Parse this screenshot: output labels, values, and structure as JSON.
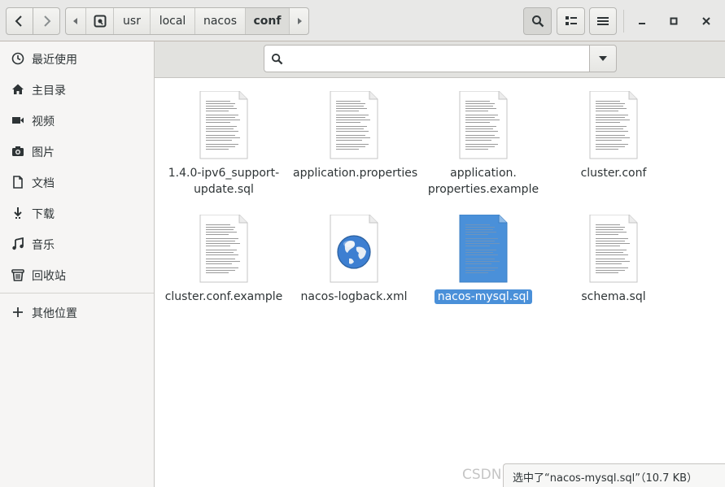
{
  "header": {
    "path": [
      {
        "label": "",
        "icon": "drive-icon"
      },
      {
        "label": "usr"
      },
      {
        "label": "local"
      },
      {
        "label": "nacos"
      },
      {
        "label": "conf"
      }
    ]
  },
  "sidebar": {
    "items": [
      {
        "label": "最近使用",
        "icon": "clock-icon"
      },
      {
        "label": "主目录",
        "icon": "home-icon"
      },
      {
        "label": "视频",
        "icon": "video-icon"
      },
      {
        "label": "图片",
        "icon": "camera-icon"
      },
      {
        "label": "文档",
        "icon": "document-icon"
      },
      {
        "label": "下载",
        "icon": "download-icon"
      },
      {
        "label": "音乐",
        "icon": "music-icon"
      },
      {
        "label": "回收站",
        "icon": "trash-icon"
      }
    ],
    "other": {
      "label": "其他位置",
      "icon": "plus-icon"
    }
  },
  "search": {
    "value": "",
    "placeholder": ""
  },
  "files": [
    {
      "name1": "1.4.0-ipv6_support-",
      "name2": "update.sql",
      "type": "text"
    },
    {
      "name1": "application.properties",
      "name2": "",
      "type": "text"
    },
    {
      "name1": "application.",
      "name2": "properties.example",
      "type": "text"
    },
    {
      "name1": "cluster.conf",
      "name2": "",
      "type": "text"
    },
    {
      "name1": "cluster.conf.example",
      "name2": "",
      "type": "text"
    },
    {
      "name1": "nacos-logback.xml",
      "name2": "",
      "type": "xml"
    },
    {
      "name1": "nacos-mysql.sql",
      "name2": "",
      "type": "text",
      "selected": true
    },
    {
      "name1": "schema.sql",
      "name2": "",
      "type": "text"
    }
  ],
  "status": {
    "text": "选中了“nacos-mysql.sql”（10.7 KB）"
  },
  "watermark": "CSDN @日会写HelloWorld的程序员",
  "colors": {
    "accent": "#4a90d9",
    "sidebar": "#f6f5f4",
    "header": "#e8e8e7"
  }
}
